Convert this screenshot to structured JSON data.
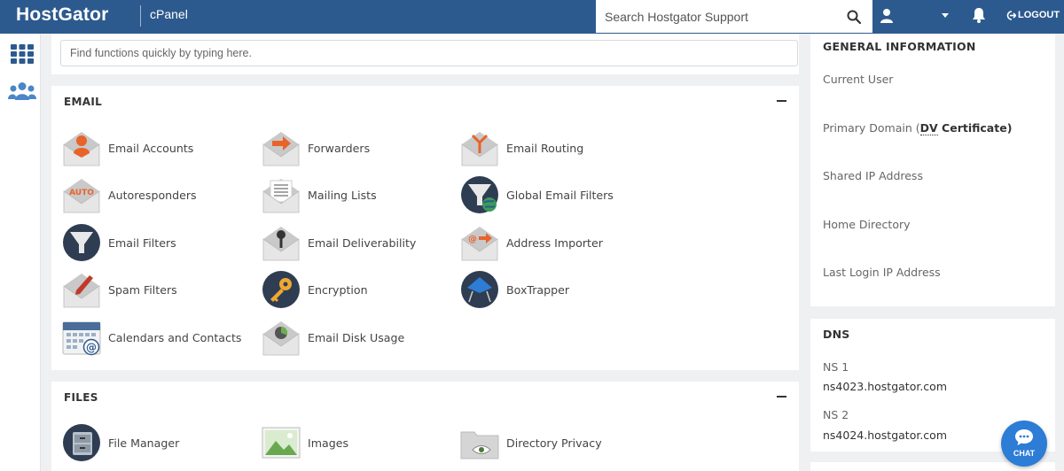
{
  "header": {
    "brand": "HostGator",
    "product": "cPanel",
    "search_placeholder": "Search Hostgator Support",
    "logout_label": "LOGOUT"
  },
  "find": {
    "placeholder": "Find functions quickly by typing here."
  },
  "email": {
    "title": "EMAIL",
    "items": [
      {
        "label": "Email Accounts",
        "icon": "email-accounts-icon"
      },
      {
        "label": "Forwarders",
        "icon": "forwarders-icon"
      },
      {
        "label": "Email Routing",
        "icon": "email-routing-icon"
      },
      {
        "label": "Autoresponders",
        "icon": "autoresponders-icon"
      },
      {
        "label": "Mailing Lists",
        "icon": "mailing-lists-icon"
      },
      {
        "label": "Global Email Filters",
        "icon": "global-email-filters-icon"
      },
      {
        "label": "Email Filters",
        "icon": "email-filters-icon"
      },
      {
        "label": "Email Deliverability",
        "icon": "email-deliverability-icon"
      },
      {
        "label": "Address Importer",
        "icon": "address-importer-icon"
      },
      {
        "label": "Spam Filters",
        "icon": "spam-filters-icon"
      },
      {
        "label": "Encryption",
        "icon": "encryption-icon"
      },
      {
        "label": "BoxTrapper",
        "icon": "boxtrapper-icon"
      },
      {
        "label": "Calendars and Contacts",
        "icon": "calendars-contacts-icon"
      },
      {
        "label": "Email Disk Usage",
        "icon": "email-disk-usage-icon"
      }
    ]
  },
  "files": {
    "title": "FILES",
    "items": [
      {
        "label": "File Manager",
        "icon": "file-manager-icon"
      },
      {
        "label": "Images",
        "icon": "images-icon"
      },
      {
        "label": "Directory Privacy",
        "icon": "directory-privacy-icon"
      }
    ]
  },
  "general": {
    "title": "GENERAL INFORMATION",
    "current_user": "Current User",
    "primary_domain": "Primary Domain (",
    "primary_domain_dv": "DV",
    "primary_domain_cert": " Certificate)",
    "shared_ip": "Shared IP Address",
    "home_dir": "Home Directory",
    "last_login": "Last Login IP Address"
  },
  "dns": {
    "title": "DNS",
    "ns1_label": "NS 1",
    "ns1_value": "ns4023.hostgator.com",
    "ns2_label": "NS 2",
    "ns2_value": "ns4024.hostgator.com"
  },
  "chat": {
    "label": "CHAT"
  },
  "colors": {
    "header": "#2d5a8e",
    "accent_orange": "#e8632a",
    "chat_blue": "#2d7cd6"
  }
}
